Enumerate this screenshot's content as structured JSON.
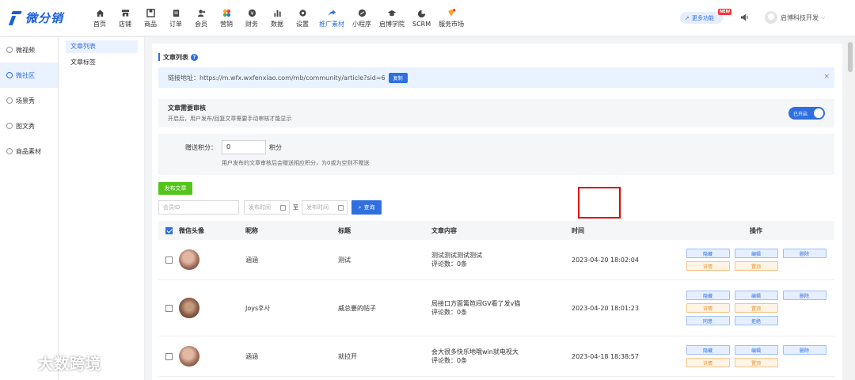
{
  "brand": {
    "name": "微分销",
    "color": "#1e5fd6"
  },
  "nav": [
    {
      "label": "首页",
      "icon": "home-icon"
    },
    {
      "label": "店铺",
      "icon": "store-icon"
    },
    {
      "label": "商品",
      "icon": "product-icon"
    },
    {
      "label": "订单",
      "icon": "order-icon"
    },
    {
      "label": "会员",
      "icon": "member-icon"
    },
    {
      "label": "营销",
      "icon": "marketing-icon"
    },
    {
      "label": "财务",
      "icon": "finance-icon"
    },
    {
      "label": "数据",
      "icon": "chart-icon"
    },
    {
      "label": "设置",
      "icon": "gear-icon"
    },
    {
      "label": "推广素材",
      "icon": "share-icon",
      "active": true
    },
    {
      "label": "小程序",
      "icon": "miniapp-icon"
    },
    {
      "label": "启博学院",
      "icon": "graduation-icon"
    },
    {
      "label": "SCRM",
      "icon": "pie-icon"
    },
    {
      "label": "服务市场",
      "icon": "diamond-icon"
    }
  ],
  "header": {
    "more_label": "更多功能",
    "new_badge": "NEW",
    "user_name": "启博科技开发"
  },
  "sidebar": [
    {
      "label": "微视频"
    },
    {
      "label": "微社区",
      "active": true
    },
    {
      "label": "场景秀"
    },
    {
      "label": "图文秀"
    },
    {
      "label": "商品素材"
    }
  ],
  "subsidebar": [
    {
      "label": "文章列表",
      "active": true
    },
    {
      "label": "文章标签"
    }
  ],
  "main": {
    "title": "文章列表",
    "help": "?",
    "link_prefix": "链接地址：",
    "link_url": "https://m.wfx.wxfenxiao.com/mb/community/article?sid=6",
    "copy_label": "复制",
    "close": "×",
    "review_title": "文章需要审核",
    "review_desc": "开启后，用户发布/回复文章需要手动审核才能显示",
    "toggle_label": "已开启",
    "points_label": "赠送积分：",
    "points_value": "0",
    "points_unit": "积分",
    "points_desc": "用户发布的文章审核后会赠送相应积分，为0或为空则不赠送",
    "publish_label": "发布文章",
    "filter_member_placeholder": "会员ID",
    "filter_start_placeholder": "发布时间",
    "filter_sep": "至",
    "filter_end_placeholder": "发布时间",
    "query_label": "查询"
  },
  "table": {
    "headers": [
      "微信头像",
      "昵称",
      "标题",
      "文章内容",
      "时间",
      "操作"
    ],
    "rows": [
      {
        "nick": "涵涵",
        "title": "测试",
        "content": "测试测试测试测试",
        "comments": "评论数：0条",
        "time": "2023-04-20 18:02:04",
        "ops": [
          [
            "隐藏",
            "编辑",
            "删除"
          ],
          [
            "详情",
            "置顶"
          ]
        ]
      },
      {
        "nick": "Joys후사",
        "title": "威总要的帖子",
        "content": "局接口方面篱笆间GV看了发v猫",
        "comments": "评论数：0条",
        "time": "2023-04-20 18:01:23",
        "ops": [
          [
            "隐藏",
            "编辑",
            "删除"
          ],
          [
            "详情",
            "置顶"
          ],
          [
            "同意",
            "拒绝"
          ]
        ]
      },
      {
        "nick": "涵涵",
        "title": "就拉开",
        "content": "会大很多快乐地哦win就电视大",
        "comments": "评论数：0条",
        "time": "2023-04-18 18:38:57",
        "ops": [
          [
            "隐藏",
            "编辑",
            "删除"
          ],
          [
            "详情",
            "置顶"
          ]
        ]
      }
    ]
  },
  "watermark": "大数跨境"
}
